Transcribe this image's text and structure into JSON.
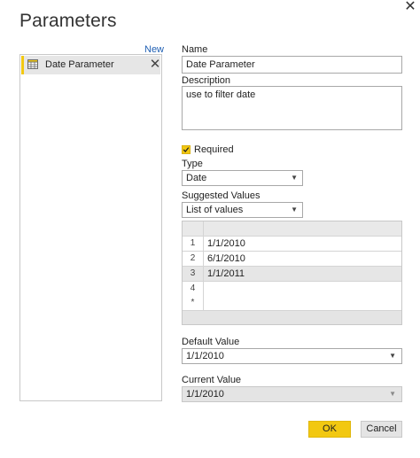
{
  "dialog": {
    "title": "Parameters",
    "close_icon": "close-icon"
  },
  "sidebar": {
    "new_label": "New",
    "items": [
      {
        "label": "Date Parameter",
        "icon": "table-icon",
        "remove_icon": "close-icon"
      }
    ]
  },
  "form": {
    "name_label": "Name",
    "name_value": "Date Parameter",
    "description_label": "Description",
    "description_value": "use  to filter date",
    "required_label": "Required",
    "required_checked": true,
    "type_label": "Type",
    "type_value": "Date",
    "suggested_label": "Suggested Values",
    "suggested_value": "List of values",
    "values_list": [
      {
        "index": "1",
        "value": "1/1/2010"
      },
      {
        "index": "2",
        "value": "6/1/2010"
      },
      {
        "index": "3",
        "value": "1/1/2011"
      },
      {
        "index": "4",
        "value": ""
      },
      {
        "index": "*",
        "value": ""
      }
    ],
    "default_label": "Default Value",
    "default_value": "1/1/2010",
    "current_label": "Current Value",
    "current_value": "1/1/2010"
  },
  "buttons": {
    "ok_label": "OK",
    "cancel_label": "Cancel"
  },
  "colors": {
    "accent": "#f2c811",
    "link": "#1f5fb3",
    "selection": "#e6e6e6"
  }
}
